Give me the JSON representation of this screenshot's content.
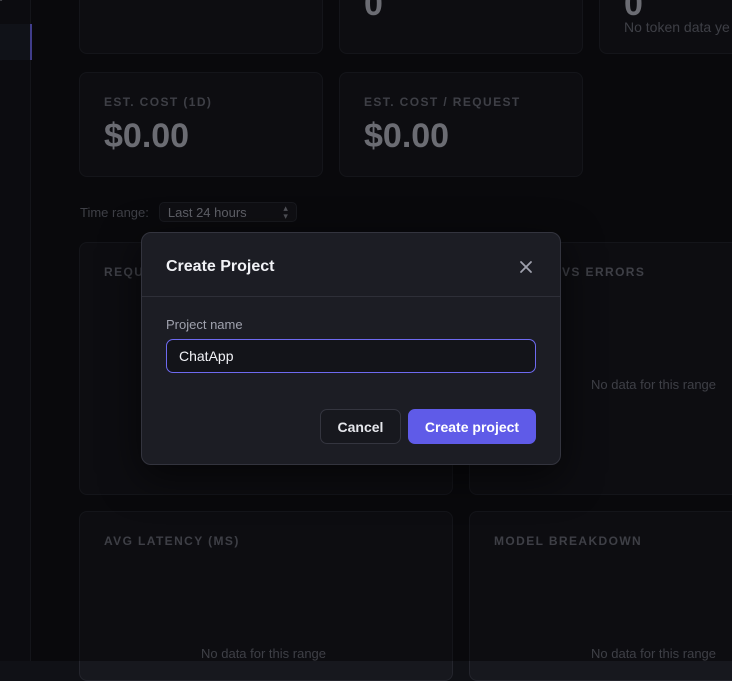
{
  "dashboard": {
    "top_row": [
      {
        "value": "0",
        "note": ""
      },
      {
        "value": "0",
        "note": "No token data ye"
      }
    ],
    "cost_cards": [
      {
        "label": "EST. COST (1D)",
        "value": "$0.00"
      },
      {
        "label": "EST. COST / REQUEST",
        "value": "$0.00"
      }
    ],
    "time_range": {
      "label": "Time range:",
      "selected": "Last 24 hours"
    },
    "charts": [
      {
        "label": "REQU",
        "empty": ""
      },
      {
        "label": "VS ERRORS",
        "empty": "No data for this range"
      },
      {
        "label": "AVG LATENCY (MS)",
        "empty": "No data for this range"
      },
      {
        "label": "MODEL BREAKDOWN",
        "empty": "No data for this range"
      }
    ]
  },
  "modal": {
    "title": "Create Project",
    "field_label": "Project name",
    "input_value": "ChatApp",
    "cancel_label": "Cancel",
    "create_label": "Create project"
  },
  "colors": {
    "accent": "#5f5be8",
    "background": "#101116",
    "card": "#17181e",
    "modal": "#1c1d24"
  }
}
